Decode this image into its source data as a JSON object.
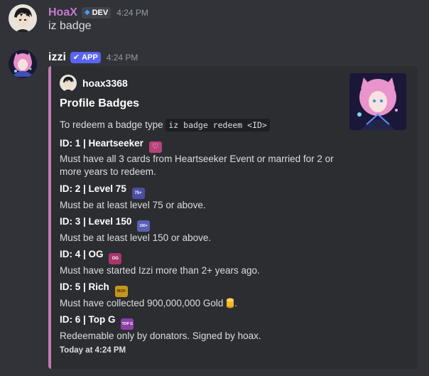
{
  "messages": [
    {
      "author": "HoaX",
      "author_color": "#c27bcd",
      "tag": "DEV",
      "time": "4:24 PM",
      "text": "iz badge"
    },
    {
      "author": "izzi",
      "author_color": "#ffffff",
      "tag": "APP",
      "time": "4:24 PM",
      "embed": {
        "accent": "#c379b7",
        "author": "hoax3368",
        "title": "Profile Badges",
        "intro": "To redeem a badge type",
        "command": "iz badge redeem <ID>",
        "badges": [
          {
            "title": "ID: 1 | Heartseeker",
            "emoji": "heart-badge-icon",
            "color": "#b5437a",
            "desc_line1": "Must have all 3 cards from Heartseeker Event or married for 2 or",
            "desc_line2": "more years to redeem."
          },
          {
            "title": "ID: 2 | Level 75",
            "emoji": "level-75-badge-icon",
            "emoji_text": "75+",
            "color": "#4a4ea3",
            "desc": "Must be at least level 75 or above."
          },
          {
            "title": "ID: 3 | Level 150",
            "emoji": "level-150-badge-icon",
            "emoji_text": "150+",
            "color": "#5a5fb5",
            "desc": "Must be at least level 150 or above."
          },
          {
            "title": "ID: 4 | OG",
            "emoji": "og-badge-icon",
            "emoji_text": "OG",
            "color": "#a8356b",
            "desc": "Must have started Izzi more than 2+ years ago."
          },
          {
            "title": "ID: 5 | Rich",
            "emoji": "rich-badge-icon",
            "emoji_text": "RICH",
            "color": "#c8961e",
            "desc": "Must have collected 900,000,000 Gold",
            "desc_suffix": "."
          },
          {
            "title": "ID: 6 | Top G",
            "emoji": "top-g-badge-icon",
            "emoji_text": "TOP G",
            "color": "#8b3fa8",
            "desc": "Redeemable only by donators. Signed by hoax."
          }
        ],
        "footer": "Today at 4:24 PM"
      }
    }
  ]
}
